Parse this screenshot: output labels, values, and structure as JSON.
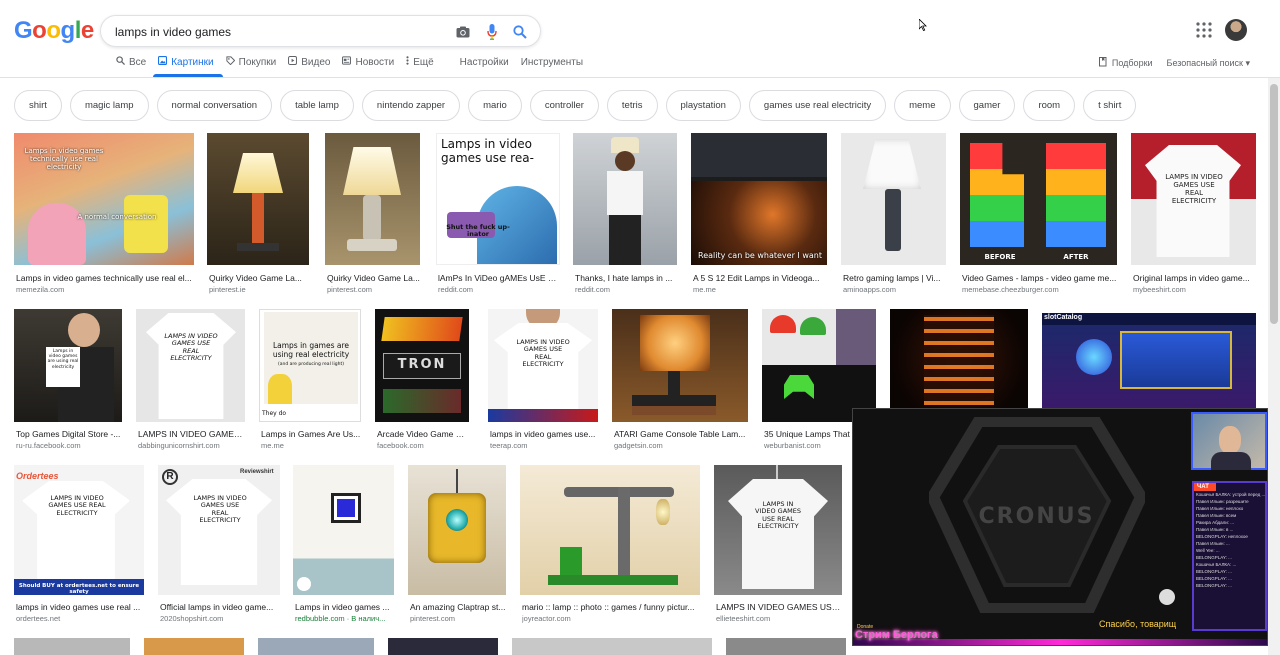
{
  "search": {
    "query": "lamps in video games"
  },
  "logo_letters": [
    "G",
    "o",
    "o",
    "g",
    "l",
    "e"
  ],
  "tabs": [
    {
      "label": "Все",
      "icon": "search-icon"
    },
    {
      "label": "Картинки",
      "icon": "image-icon"
    },
    {
      "label": "Покупки",
      "icon": "tag-icon"
    },
    {
      "label": "Видео",
      "icon": "play-icon"
    },
    {
      "label": "Новости",
      "icon": "news-icon"
    },
    {
      "label": "Ещё",
      "icon": "more-icon"
    },
    {
      "label": "Настройки",
      "icon": ""
    },
    {
      "label": "Инструменты",
      "icon": ""
    }
  ],
  "right_tools": {
    "collections": "Подборки",
    "safe_search": "Безопасный поиск ▾"
  },
  "chips": [
    "shirt",
    "magic lamp",
    "normal conversation",
    "table lamp",
    "nintendo zapper",
    "mario",
    "controller",
    "tetris",
    "playstation",
    "games use real electricity",
    "meme",
    "gamer",
    "room",
    "t shirt"
  ],
  "thumb_texts": {
    "r1_1_top": "Lamps in video games technically use real electricity",
    "r1_1_mid": "A normal conversation",
    "r1_4_top": "Lamps in video games use rea-",
    "r1_4_mid": "Shut the fuck up-inator",
    "r1_7_bottom": "Reality can be whatever I want",
    "r1_9_before": "BEFORE",
    "r1_9_after": "AFTER",
    "r1_10_shirt": "LAMPS IN VIDEO GAMES USE REAL ELECTRICITY",
    "r2_1_sign": "Lamps in video games are using real electricity",
    "r2_2_shirt": "LAMPS IN VIDEO GAMES USE REAL ELECTRICITY",
    "r2_3_sign": "Lamps in games are using real electricity",
    "r2_3_small": "(and are producing real light)",
    "r2_3_caption": "They do",
    "r2_4_logo": "TRON",
    "r2_5_shirt": "LAMPS IN VIDEO GAMES USE REAL ELECTRICITY",
    "r3_1_brand": "Ordertees",
    "r3_1_shirt": "LAMPS IN VIDEO GAMES USE REAL ELECTRICITY",
    "r3_1_promo": "Should BUY at ordertees.net to ensure safety",
    "r3_2_shirt": "LAMPS IN VIDEO GAMES USE REAL ELECTRICITY",
    "r3_6_shirt": "LAMPS IN VIDEO GAMES USE REAL ELECTRICITY",
    "r2_9_brand": "slotCatalog",
    "r3_2_brand": "Reviewshirt"
  },
  "images": [
    {
      "title": "Lamps in video games technically use real el...",
      "source": "memezila.com"
    },
    {
      "title": "Quirky Video Game La...",
      "source": "pinterest.ie"
    },
    {
      "title": "Quirky Video Game La...",
      "source": "pinterest.com"
    },
    {
      "title": "lAmPs In ViDeo gAMEs UsE R...",
      "source": "reddit.com"
    },
    {
      "title": "Thanks, I hate lamps in ...",
      "source": "reddit.com"
    },
    {
      "title": "A 5 S 12 Edit Lamps in Videoga...",
      "source": "me.me"
    },
    {
      "title": "Retro gaming lamps | Vi...",
      "source": "aminoapps.com"
    },
    {
      "title": "Video Games - lamps - video game me...",
      "source": "memebase.cheezburger.com"
    },
    {
      "title": "Original lamps in video game...",
      "source": "mybeeshirt.com"
    },
    {
      "title": "Top Games Digital Store -...",
      "source": "ru-ru.facebook.com"
    },
    {
      "title": "LAMPS IN VIDEO GAMES ...",
      "source": "dabbingunicornshirt.com"
    },
    {
      "title": "Lamps in Games Are Us...",
      "source": "me.me"
    },
    {
      "title": "Arcade Video Game W...",
      "source": "facebook.com"
    },
    {
      "title": "lamps in video games use...",
      "source": "teerap.com"
    },
    {
      "title": "ATARI Game Console Table Lam...",
      "source": "gadgetsin.com"
    },
    {
      "title": "35 Unique Lamps That",
      "source": "weburbanist.com"
    },
    {
      "title": "lamps in video games use real ...",
      "source": "ordertees.net"
    },
    {
      "title": "Official lamps in video game...",
      "source": "2020shopshirt.com"
    },
    {
      "title": "Lamps in video games ...",
      "source": "redbubble.com · В налич..."
    },
    {
      "title": "An amazing Claptrap st...",
      "source": "pinterest.com"
    },
    {
      "title": "mario :: lamp :: photo :: games / funny pictur...",
      "source": "joyreactor.com"
    },
    {
      "title": "LAMPS IN VIDEO GAMES USE ...",
      "source": "ellieteeshirt.com"
    }
  ],
  "overlay": {
    "logo_text": "CRONUS",
    "stream_title": "Стрим Берлога",
    "stream_sub": "Donate",
    "thanks": "Спасибо, товарищ",
    "chat_header": "ЧАТ",
    "chat": [
      "Кошачья БАЛКА: устрой перед ...",
      "Павел Ильин: разрешите",
      "Павел Ильин: неплохо",
      "Павел Ильин: всем",
      "Ракира Абдали: ...",
      "Павел Ильин: в ...",
      "BELONGPLAY: неплохое",
      "Павел Ильин: ...",
      "Well Yee: ...",
      "BELONGPLAY: ...",
      "Кошачья БАЛКА: ...",
      "BELONGPLAY: ...",
      "BELONGPLAY: ...",
      "BELONGPLAY: ..."
    ]
  },
  "colors": {
    "blue": "#4285f4",
    "red": "#ea4335",
    "yellow": "#fbbc05",
    "green": "#34a853",
    "accent": "#1a73e8"
  }
}
